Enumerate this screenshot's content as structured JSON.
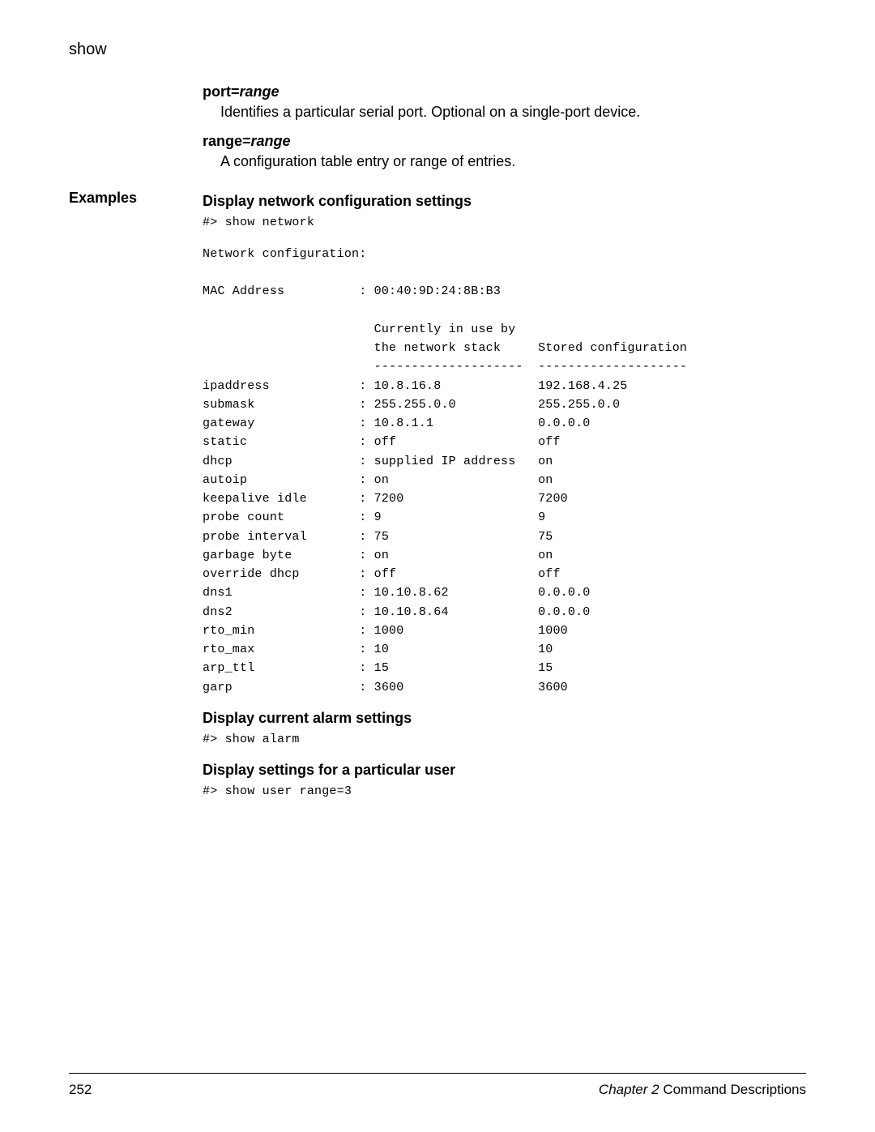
{
  "header": {
    "title": "show"
  },
  "options": {
    "port": {
      "label_prefix": "port=",
      "label_ital": "range",
      "desc": "Identifies a particular serial port. Optional on a single-port device."
    },
    "range": {
      "label_prefix": "range=",
      "label_ital": "range",
      "desc": "A configuration table entry or range of entries."
    }
  },
  "examples_label": "Examples",
  "examples": {
    "net": {
      "title": "Display network configuration settings",
      "cmd": "#> show network",
      "output": "Network configuration:\n\nMAC Address          : 00:40:9D:24:8B:B3\n\n                       Currently in use by\n                       the network stack     Stored configuration\n                       --------------------  --------------------\nipaddress            : 10.8.16.8             192.168.4.25\nsubmask              : 255.255.0.0           255.255.0.0\ngateway              : 10.8.1.1              0.0.0.0\nstatic               : off                   off\ndhcp                 : supplied IP address   on\nautoip               : on                    on\nkeepalive idle       : 7200                  7200\nprobe count          : 9                     9\nprobe interval       : 75                    75\ngarbage byte         : on                    on\noverride dhcp        : off                   off\ndns1                 : 10.10.8.62            0.0.0.0\ndns2                 : 10.10.8.64            0.0.0.0\nrto_min              : 1000                  1000\nrto_max              : 10                    10\narp_ttl              : 15                    15\ngarp                 : 3600                  3600"
    },
    "alarm": {
      "title": "Display current alarm settings",
      "cmd": "#> show alarm"
    },
    "user": {
      "title": "Display settings for a particular user",
      "cmd": "#> show user range=3"
    }
  },
  "footer": {
    "page_number": "252",
    "chapter_prefix": "Chapter 2",
    "chapter_suffix": "   Command Descriptions"
  }
}
